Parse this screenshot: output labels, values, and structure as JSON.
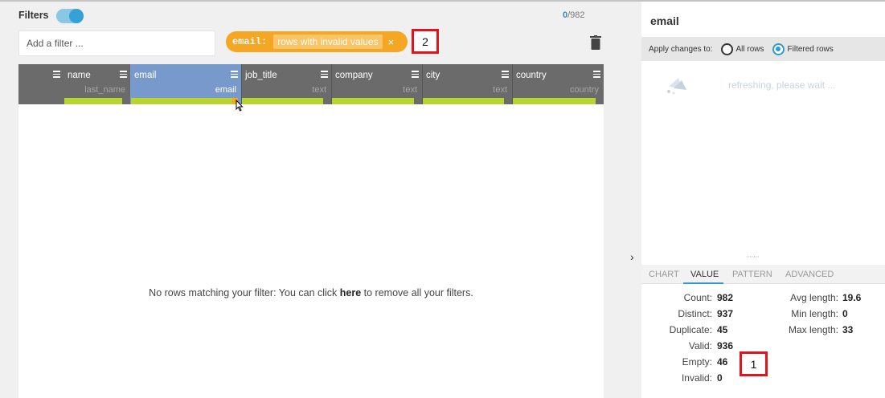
{
  "filters": {
    "label": "Filters",
    "enabled": true,
    "count_matched": "0",
    "count_total": "/982",
    "add_placeholder": "Add a filter ..."
  },
  "active_filter": {
    "column": "email:",
    "condition": "rows with invalid values",
    "remove": "×"
  },
  "annotations": {
    "a1": "1",
    "a2": "2"
  },
  "columns": [
    {
      "name": "name",
      "type": "last_name"
    },
    {
      "name": "email",
      "type": "email"
    },
    {
      "name": "job_title",
      "type": "text"
    },
    {
      "name": "company",
      "type": "text"
    },
    {
      "name": "city",
      "type": "text"
    },
    {
      "name": "country",
      "type": "country"
    }
  ],
  "empty_message": {
    "before": "No rows matching your filter: You can click ",
    "link": "here",
    "after": " to remove all your filters."
  },
  "panel": {
    "title": "email",
    "apply_label": "Apply changes to:",
    "option_all": "All rows",
    "option_filtered": "Filtered rows",
    "selected_option": "Filtered rows",
    "loading_text": "refreshing, please wait ...",
    "tabs": [
      "CHART",
      "VALUE",
      "PATTERN",
      "ADVANCED"
    ],
    "active_tab": "VALUE",
    "stats_left": [
      {
        "label": "Count:",
        "value": "982"
      },
      {
        "label": "Distinct:",
        "value": "937"
      },
      {
        "label": "Duplicate:",
        "value": "45"
      },
      {
        "label": "Valid:",
        "value": "936"
      },
      {
        "label": "Empty:",
        "value": "46"
      },
      {
        "label": "Invalid:",
        "value": "0"
      }
    ],
    "stats_right": [
      {
        "label": "Avg length:",
        "value": "19.6"
      },
      {
        "label": "Min length:",
        "value": "0"
      },
      {
        "label": "Max length:",
        "value": "33"
      }
    ]
  },
  "colors": {
    "accent": "#2e9ad0",
    "filter_pill": "#f5a623",
    "selected_column": "#7799cc",
    "valid_bar": "#b8d432",
    "annotation_border": "#e0141e"
  }
}
